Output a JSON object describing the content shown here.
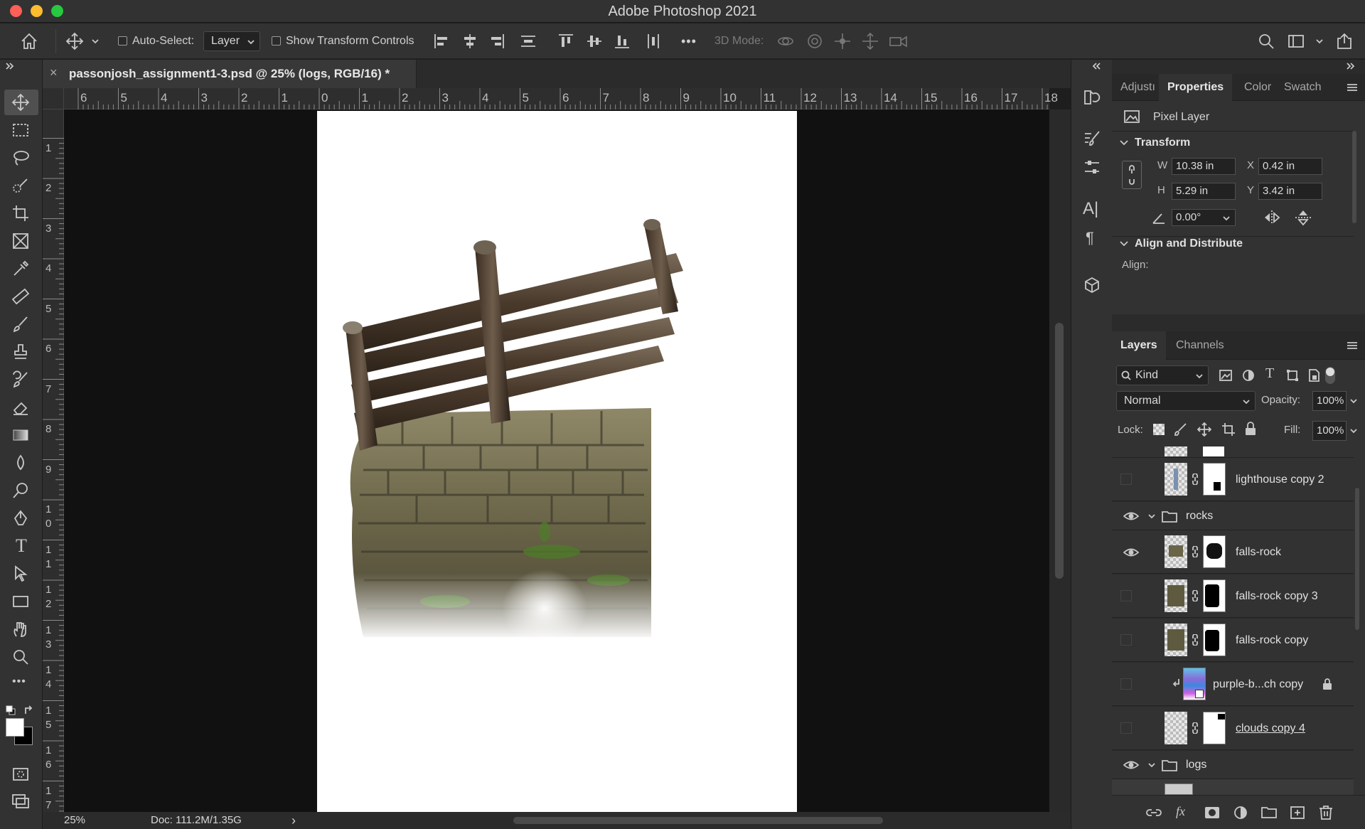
{
  "app": {
    "title": "Adobe Photoshop 2021"
  },
  "options_bar": {
    "auto_select_label": "Auto-Select:",
    "auto_select_value": "Layer",
    "show_transform_label": "Show Transform Controls",
    "mode_3d_label": "3D Mode:",
    "more_label": "•••"
  },
  "document": {
    "tab_title": "passonjosh_assignment1-3.psd @ 25% (logs, RGB/16) *",
    "close_glyph": "×"
  },
  "rulers": {
    "top": [
      "6",
      "5",
      "4",
      "3",
      "2",
      "1",
      "0",
      "1",
      "2",
      "3",
      "4",
      "5",
      "6",
      "7",
      "8",
      "9",
      "10",
      "11",
      "12",
      "13",
      "14",
      "15",
      "16",
      "17",
      "18"
    ],
    "left": [
      "1",
      "2",
      "3",
      "4",
      "5",
      "6",
      "7",
      "8",
      "9",
      "10",
      "11",
      "12",
      "13",
      "14",
      "15",
      "16",
      "17"
    ]
  },
  "status": {
    "zoom": "25%",
    "doc": "Doc: 111.2M/1.35G",
    "arrow": "›"
  },
  "colors": {
    "foreground": "#ffffff",
    "background": "#000000",
    "accent": "#1473e6"
  },
  "properties_panel": {
    "tabs": [
      "Adjustı",
      "Properties",
      "Color",
      "Swatch"
    ],
    "active_tab": "Properties",
    "layer_type": "Pixel Layer",
    "transform_title": "Transform",
    "w_label": "W",
    "w_value": "10.38 in",
    "h_label": "H",
    "h_value": "5.29 in",
    "x_label": "X",
    "x_value": "0.42 in",
    "y_label": "Y",
    "y_value": "3.42 in",
    "angle_value": "0.00°",
    "align_title": "Align and Distribute",
    "align_label": "Align:"
  },
  "layers_panel": {
    "tabs": [
      "Layers",
      "Channels"
    ],
    "active_tab": "Layers",
    "filter_value": "Kind",
    "blend_mode": "Normal",
    "opacity_label": "Opacity:",
    "opacity_value": "100%",
    "lock_label": "Lock:",
    "fill_label": "Fill:",
    "fill_value": "100%",
    "layers": [
      {
        "name": "lighthouse copy 2",
        "visible": false,
        "kind": "layer"
      },
      {
        "name": "rocks",
        "visible": true,
        "kind": "group"
      },
      {
        "name": "falls-rock",
        "visible": true,
        "kind": "layer"
      },
      {
        "name": "falls-rock copy 3",
        "visible": false,
        "kind": "layer"
      },
      {
        "name": "falls-rock copy",
        "visible": false,
        "kind": "layer"
      },
      {
        "name": "purple-b...ch copy",
        "visible": false,
        "kind": "smart"
      },
      {
        "name": "clouds copy 4",
        "visible": false,
        "kind": "layer"
      },
      {
        "name": "logs",
        "visible": true,
        "kind": "group"
      }
    ],
    "footer_fx": "fx"
  }
}
